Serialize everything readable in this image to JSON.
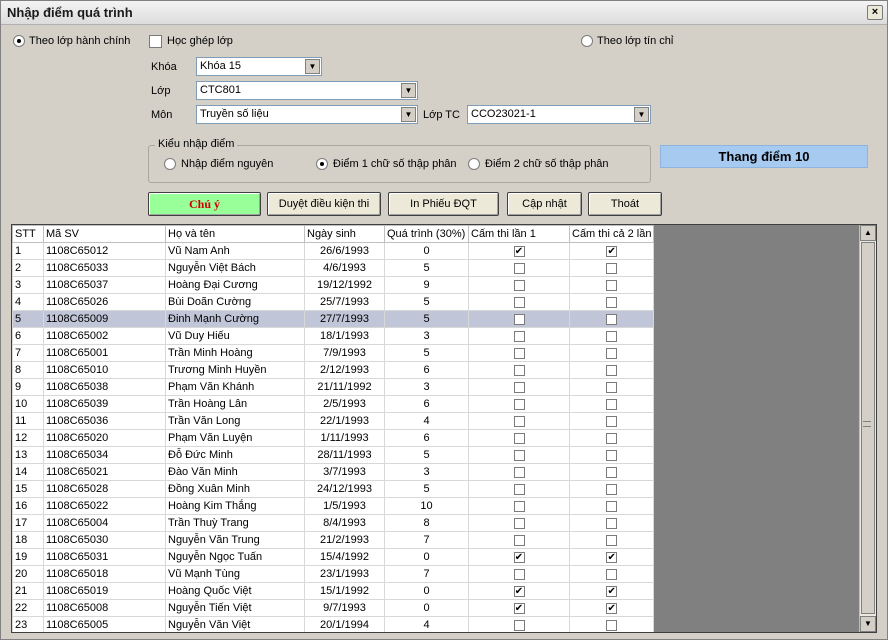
{
  "window": {
    "title": "Nhập điểm quá trình",
    "close": "×"
  },
  "mode": {
    "by_class": "Theo lớp hành chính",
    "merge_class": "Học ghép lớp",
    "by_credit": "Theo lớp tín chỉ"
  },
  "filters": {
    "khoa_label": "Khóa",
    "khoa_value": "Khóa 15",
    "lop_label": "Lớp",
    "lop_value": "CTC801",
    "mon_label": "Môn",
    "mon_value": "Truyền số liệu",
    "loptc_label": "Lớp TC",
    "loptc_value": "CCO23021-1"
  },
  "entry_type": {
    "legend": "Kiểu nhập điểm",
    "integer": "Nhập điểm nguyên",
    "one_decimal": "Điểm 1 chữ số thập phân",
    "two_decimal": "Điểm 2 chữ số thập phân",
    "selected": "one_decimal"
  },
  "scale": "Thang điểm 10",
  "buttons": {
    "note": "Chú ý",
    "review": "Duyệt điều kiện thi",
    "print": "In Phiếu ĐQT",
    "update": "Cập nhật",
    "exit": "Thoát"
  },
  "table": {
    "headers": [
      "STT",
      "Mã SV",
      "Họ và tên",
      "Ngày sinh",
      "Quá trình (30%)",
      "Cấm thi lần 1",
      "Cấm thi cả 2 lần"
    ],
    "selected_row": 5,
    "rows": [
      {
        "stt": "1",
        "ma": "1108C65012",
        "ten": "Vũ Nam Anh",
        "ns": "26/6/1993",
        "qt": "0",
        "c1": true,
        "c2": true
      },
      {
        "stt": "2",
        "ma": "1108C65033",
        "ten": "Nguyễn Việt Bách",
        "ns": "4/6/1993",
        "qt": "5",
        "c1": false,
        "c2": false
      },
      {
        "stt": "3",
        "ma": "1108C65037",
        "ten": "Hoàng Đại Cương",
        "ns": "19/12/1992",
        "qt": "9",
        "c1": false,
        "c2": false
      },
      {
        "stt": "4",
        "ma": "1108C65026",
        "ten": "Bùi Doãn Cường",
        "ns": "25/7/1993",
        "qt": "5",
        "c1": false,
        "c2": false
      },
      {
        "stt": "5",
        "ma": "1108C65009",
        "ten": "Đinh Mạnh Cường",
        "ns": "27/7/1993",
        "qt": "5",
        "c1": false,
        "c2": false
      },
      {
        "stt": "6",
        "ma": "1108C65002",
        "ten": "Vũ Duy Hiếu",
        "ns": "18/1/1993",
        "qt": "3",
        "c1": false,
        "c2": false
      },
      {
        "stt": "7",
        "ma": "1108C65001",
        "ten": "Trần Minh Hoàng",
        "ns": "7/9/1993",
        "qt": "5",
        "c1": false,
        "c2": false
      },
      {
        "stt": "8",
        "ma": "1108C65010",
        "ten": "Trương Minh Huyền",
        "ns": "2/12/1993",
        "qt": "6",
        "c1": false,
        "c2": false
      },
      {
        "stt": "9",
        "ma": "1108C65038",
        "ten": "Phạm Văn Khánh",
        "ns": "21/11/1992",
        "qt": "3",
        "c1": false,
        "c2": false
      },
      {
        "stt": "10",
        "ma": "1108C65039",
        "ten": "Trần Hoàng Lân",
        "ns": "2/5/1993",
        "qt": "6",
        "c1": false,
        "c2": false
      },
      {
        "stt": "11",
        "ma": "1108C65036",
        "ten": "Trần Văn Long",
        "ns": "22/1/1993",
        "qt": "4",
        "c1": false,
        "c2": false
      },
      {
        "stt": "12",
        "ma": "1108C65020",
        "ten": "Phạm Văn Luyện",
        "ns": "1/11/1993",
        "qt": "6",
        "c1": false,
        "c2": false
      },
      {
        "stt": "13",
        "ma": "1108C65034",
        "ten": "Đỗ Đức Minh",
        "ns": "28/11/1993",
        "qt": "5",
        "c1": false,
        "c2": false
      },
      {
        "stt": "14",
        "ma": "1108C65021",
        "ten": "Đào Văn Minh",
        "ns": "3/7/1993",
        "qt": "3",
        "c1": false,
        "c2": false
      },
      {
        "stt": "15",
        "ma": "1108C65028",
        "ten": "Đồng Xuân Minh",
        "ns": "24/12/1993",
        "qt": "5",
        "c1": false,
        "c2": false
      },
      {
        "stt": "16",
        "ma": "1108C65022",
        "ten": "Hoàng Kim Thắng",
        "ns": "1/5/1993",
        "qt": "10",
        "c1": false,
        "c2": false
      },
      {
        "stt": "17",
        "ma": "1108C65004",
        "ten": "Trần Thuỳ Trang",
        "ns": "8/4/1993",
        "qt": "8",
        "c1": false,
        "c2": false
      },
      {
        "stt": "18",
        "ma": "1108C65030",
        "ten": "Nguyễn Văn Trung",
        "ns": "21/2/1993",
        "qt": "7",
        "c1": false,
        "c2": false
      },
      {
        "stt": "19",
        "ma": "1108C65031",
        "ten": "Nguyễn Ngọc Tuấn",
        "ns": "15/4/1992",
        "qt": "0",
        "c1": true,
        "c2": true
      },
      {
        "stt": "20",
        "ma": "1108C65018",
        "ten": "Vũ Mạnh Tùng",
        "ns": "23/1/1993",
        "qt": "7",
        "c1": false,
        "c2": false
      },
      {
        "stt": "21",
        "ma": "1108C65019",
        "ten": "Hoàng Quốc Việt",
        "ns": "15/1/1992",
        "qt": "0",
        "c1": true,
        "c2": true
      },
      {
        "stt": "22",
        "ma": "1108C65008",
        "ten": "Nguyễn Tiến Việt",
        "ns": "9/7/1993",
        "qt": "0",
        "c1": true,
        "c2": true
      },
      {
        "stt": "23",
        "ma": "1108C65005",
        "ten": "Nguyễn Văn Việt",
        "ns": "20/1/1994",
        "qt": "4",
        "c1": false,
        "c2": false
      }
    ]
  }
}
